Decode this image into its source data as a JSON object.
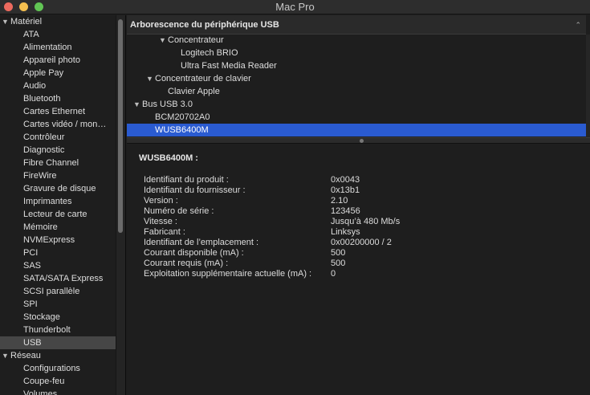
{
  "window": {
    "title": "Mac Pro"
  },
  "sidebar": {
    "groups": [
      {
        "label": "Matériel",
        "items": [
          "ATA",
          "Alimentation",
          "Appareil photo",
          "Apple Pay",
          "Audio",
          "Bluetooth",
          "Cartes Ethernet",
          "Cartes vidéo / mon…",
          "Contrôleur",
          "Diagnostic",
          "Fibre Channel",
          "FireWire",
          "Gravure de disque",
          "Imprimantes",
          "Lecteur de carte",
          "Mémoire",
          "NVMExpress",
          "PCI",
          "SAS",
          "SATA/SATA Express",
          "SCSI parallèle",
          "SPI",
          "Stockage",
          "Thunderbolt",
          "USB"
        ]
      },
      {
        "label": "Réseau",
        "items": [
          "Configurations",
          "Coupe-feu",
          "Volumes"
        ]
      }
    ],
    "selected": "USB"
  },
  "tree": {
    "header": "Arborescence du périphérique USB",
    "rows": [
      {
        "label": "Concentrateur"
      },
      {
        "label": "Logitech BRIO"
      },
      {
        "label": "Ultra Fast Media Reader"
      },
      {
        "label": "Concentrateur de clavier"
      },
      {
        "label": "Clavier Apple"
      },
      {
        "label": "Bus USB 3.0"
      },
      {
        "label": "BCM20702A0"
      },
      {
        "label": "WUSB6400M"
      }
    ],
    "selected": "WUSB6400M"
  },
  "detail": {
    "title": "WUSB6400M :",
    "properties": [
      {
        "label": "Identifiant du produit :",
        "value": "0x0043"
      },
      {
        "label": "Identifiant du fournisseur :",
        "value": "0x13b1"
      },
      {
        "label": "Version :",
        "value": "2.10"
      },
      {
        "label": "Numéro de série :",
        "value": "123456"
      },
      {
        "label": "Vitesse :",
        "value": "Jusqu’à 480 Mb/s"
      },
      {
        "label": "Fabricant :",
        "value": "Linksys"
      },
      {
        "label": "Identifiant de l’emplacement :",
        "value": "0x00200000 / 2"
      },
      {
        "label": "Courant disponible (mA) :",
        "value": "500"
      },
      {
        "label": "Courant requis (mA) :",
        "value": "500"
      },
      {
        "label": "Exploitation supplémentaire actuelle (mA) :",
        "value": "0"
      }
    ]
  },
  "icons": {
    "expanded": "disclosure-triangle-down-icon",
    "sort": "sort-ascending-icon"
  },
  "colors": {
    "selection": "#2a5bd1",
    "sidebar_selection": "#464646",
    "close": "#ed6a5e",
    "minimize": "#f5bf4f",
    "maximize": "#61c554"
  }
}
